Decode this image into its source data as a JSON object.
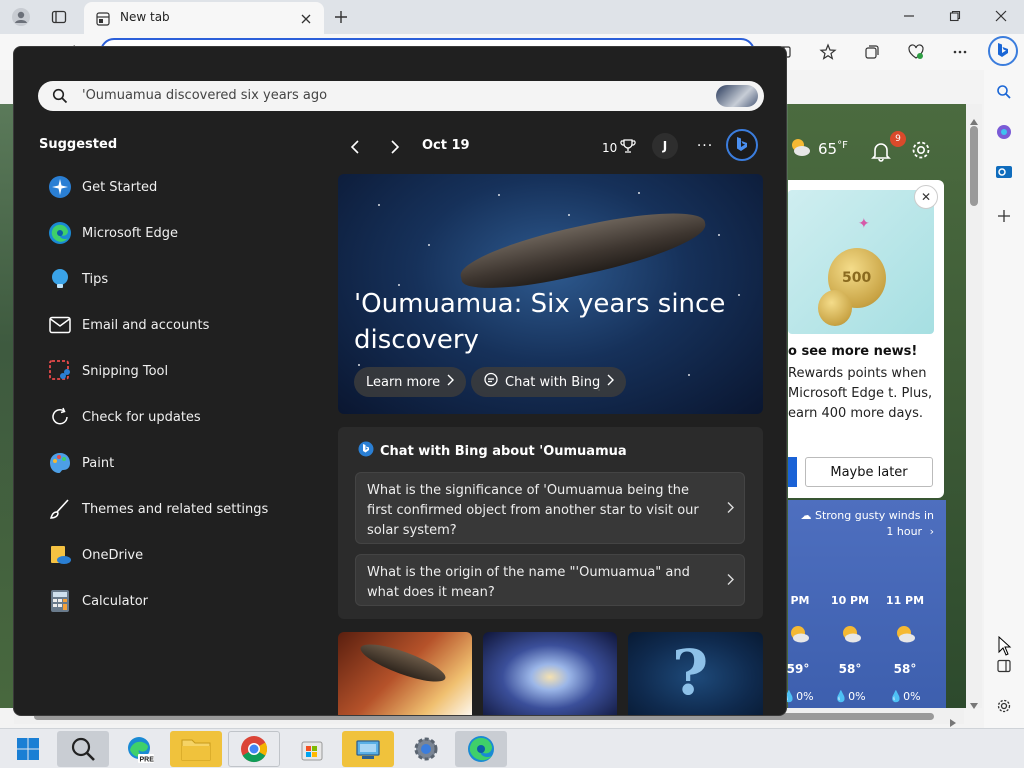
{
  "browser": {
    "tab_title": "New tab",
    "address_value": ""
  },
  "ntp": {
    "weather_temp": "65",
    "weather_unit": "°F",
    "notification_count": "9",
    "promo": {
      "coin_label": "500",
      "title": "o see more news!",
      "body": "Rewards points when Microsoft Edge t. Plus, earn 400 more days.",
      "maybe_later": "Maybe later"
    },
    "weather_card": {
      "wind_alert": "Strong gusty winds in 1 hour",
      "hours": [
        {
          "time": "PM",
          "temp": "59°",
          "precip": "0%"
        },
        {
          "time": "10 PM",
          "temp": "58°",
          "precip": "0%"
        },
        {
          "time": "11 PM",
          "temp": "58°",
          "precip": "0%"
        }
      ]
    }
  },
  "search": {
    "query": "'Oumuamua discovered six years ago",
    "suggested_heading": "Suggested",
    "apps": [
      {
        "label": "Get Started",
        "icon": "get-started-icon"
      },
      {
        "label": "Microsoft Edge",
        "icon": "edge-icon"
      },
      {
        "label": "Tips",
        "icon": "tips-icon"
      },
      {
        "label": "Email and accounts",
        "icon": "mail-icon"
      },
      {
        "label": "Snipping Tool",
        "icon": "snipping-tool-icon"
      },
      {
        "label": "Check for updates",
        "icon": "refresh-icon"
      },
      {
        "label": "Paint",
        "icon": "paint-icon"
      },
      {
        "label": "Themes and related settings",
        "icon": "brush-icon"
      },
      {
        "label": "OneDrive",
        "icon": "onedrive-icon"
      },
      {
        "label": "Calculator",
        "icon": "calculator-icon"
      }
    ],
    "date": "Oct 19",
    "points": "10",
    "avatar_initial": "J",
    "more": "···",
    "hero": {
      "title": "'Oumuamua: Six years since discovery",
      "learn_more": "Learn more",
      "chat_with_bing": "Chat with Bing"
    },
    "chat": {
      "heading": "Chat with Bing about 'Oumuamua",
      "questions": [
        "What is the significance of 'Oumuamua being the first confirmed object from another star to visit our solar system?",
        "What is the origin of the name \"'Oumuamua\" and what does it mean?"
      ]
    }
  },
  "colors": {
    "panel_bg": "#202020",
    "accent": "#2b5fd9",
    "card_bg": "#2b2b2b"
  }
}
